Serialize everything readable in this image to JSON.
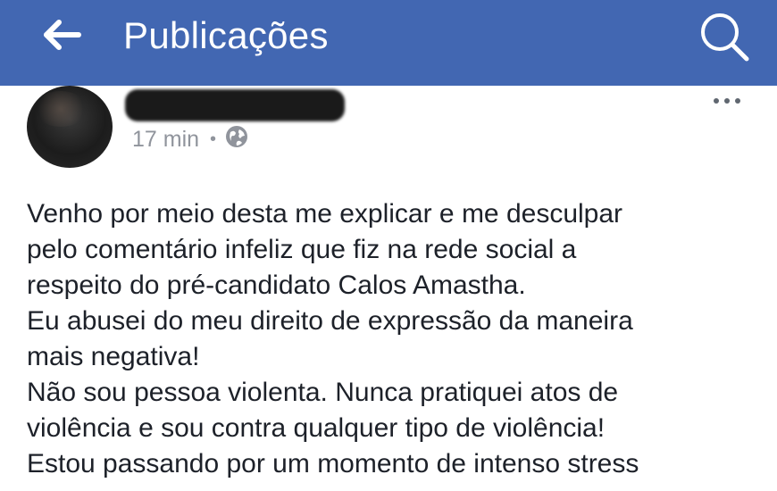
{
  "header": {
    "title": "Publicações",
    "back_icon": "arrow-left-icon",
    "search_icon": "search-icon",
    "background_color": "#4267b2"
  },
  "post": {
    "author_name": "",
    "time": "17 min",
    "separator": "•",
    "privacy_icon": "globe-icon",
    "more_icon": "more-horizontal-icon",
    "lines": [
      "Venho por meio desta me explicar e me desculpar",
      "pelo comentário infeliz que fiz na rede social a",
      "respeito do pré-candidato Calos Amastha.",
      "Eu abusei do meu direito de expressão da maneira",
      "mais negativa!",
      "Não sou pessoa violenta. Nunca pratiquei atos de",
      "violência e sou contra qualquer tipo de violência!",
      "Estou passando por um momento de intenso stress"
    ]
  }
}
